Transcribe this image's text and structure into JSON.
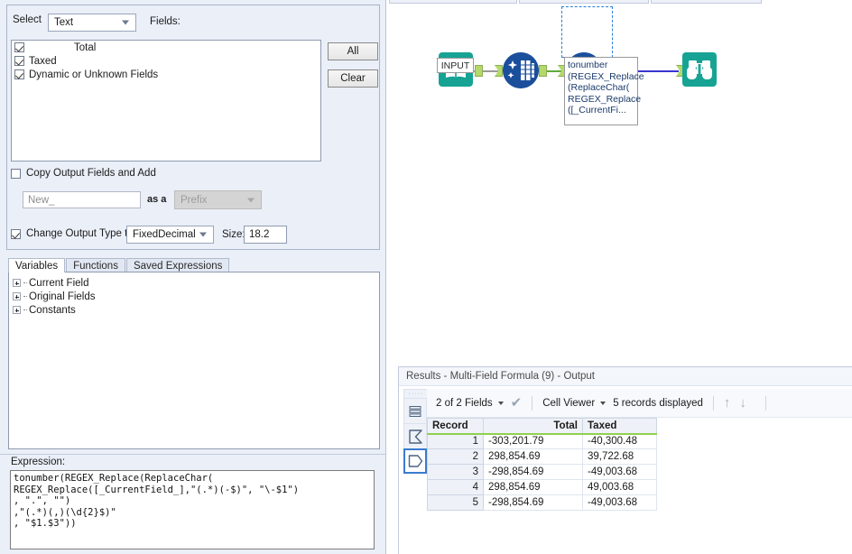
{
  "config": {
    "select_label": "Select",
    "select_value": "Text",
    "fields_label": "Fields:",
    "fields": [
      {
        "label": "Total",
        "checked": true,
        "indented": true
      },
      {
        "label": "Taxed",
        "checked": true,
        "indented": false
      },
      {
        "label": "Dynamic or Unknown Fields",
        "checked": true,
        "indented": false
      }
    ],
    "all_button": "All",
    "clear_button": "Clear",
    "copy_output_label": "Copy Output Fields and Add",
    "copy_output_checked": false,
    "new_field_placeholder": "New_",
    "as_a_label": "as a",
    "prefix_value": "Prefix",
    "change_type_label": "Change Output Type to",
    "change_type_checked": true,
    "output_type": "FixedDecimal",
    "size_label": "Size:",
    "size_value": "18.2"
  },
  "tabs": {
    "items": [
      {
        "label": "Variables",
        "active": true
      },
      {
        "label": "Functions",
        "active": false
      },
      {
        "label": "Saved Expressions",
        "active": false
      }
    ]
  },
  "variables_tree": [
    {
      "label": "Current Field"
    },
    {
      "label": "Original Fields"
    },
    {
      "label": "Constants"
    }
  ],
  "expression": {
    "label": "Expression:",
    "text": "tonumber(REGEX_Replace(ReplaceChar(\nREGEX_Replace([_CurrentField_],\"(.*)(-$)\", \"\\-$1\")\n, \".\", \"\")\n,\"(.*)(,)(\\d{2}$)\"\n, \"$1.$3\"))"
  },
  "canvas": {
    "input_label": "INPUT",
    "annotation": "tonumber\n(REGEX_Replace\n(ReplaceChar(\nREGEX_Replace\n([_CurrentFi...",
    "nodes": [
      {
        "name": "input-data-tool",
        "type": "input"
      },
      {
        "name": "select-tool",
        "type": "select"
      },
      {
        "name": "multi-field-formula-tool",
        "type": "formula",
        "selected": true
      },
      {
        "name": "browse-tool",
        "type": "browse"
      }
    ],
    "colors": {
      "teal": "#16a394",
      "navy": "#1b4f9c",
      "wire_green": "#5faa3c",
      "wire_blue": "#3a35d0"
    }
  },
  "results": {
    "title": "Results - Multi-Field Formula (9) - Output",
    "toolbar": {
      "fields_count": "2 of 2 Fields",
      "viewer": "Cell Viewer",
      "records_displayed": "5 records displayed",
      "up_arrow": "↑",
      "down_arrow": "↓",
      "check": "✔"
    },
    "columns": [
      "Record",
      "Total",
      "Taxed"
    ],
    "rows": [
      {
        "record": "1",
        "total": "-303,201.79",
        "taxed": "-40,300.48"
      },
      {
        "record": "2",
        "total": "298,854.69",
        "taxed": "39,722.68"
      },
      {
        "record": "3",
        "total": "-298,854.69",
        "taxed": "-49,003.68"
      },
      {
        "record": "4",
        "total": "298,854.69",
        "taxed": "49,003.68"
      },
      {
        "record": "5",
        "total": "-298,854.69",
        "taxed": "-49,003.68"
      }
    ]
  }
}
